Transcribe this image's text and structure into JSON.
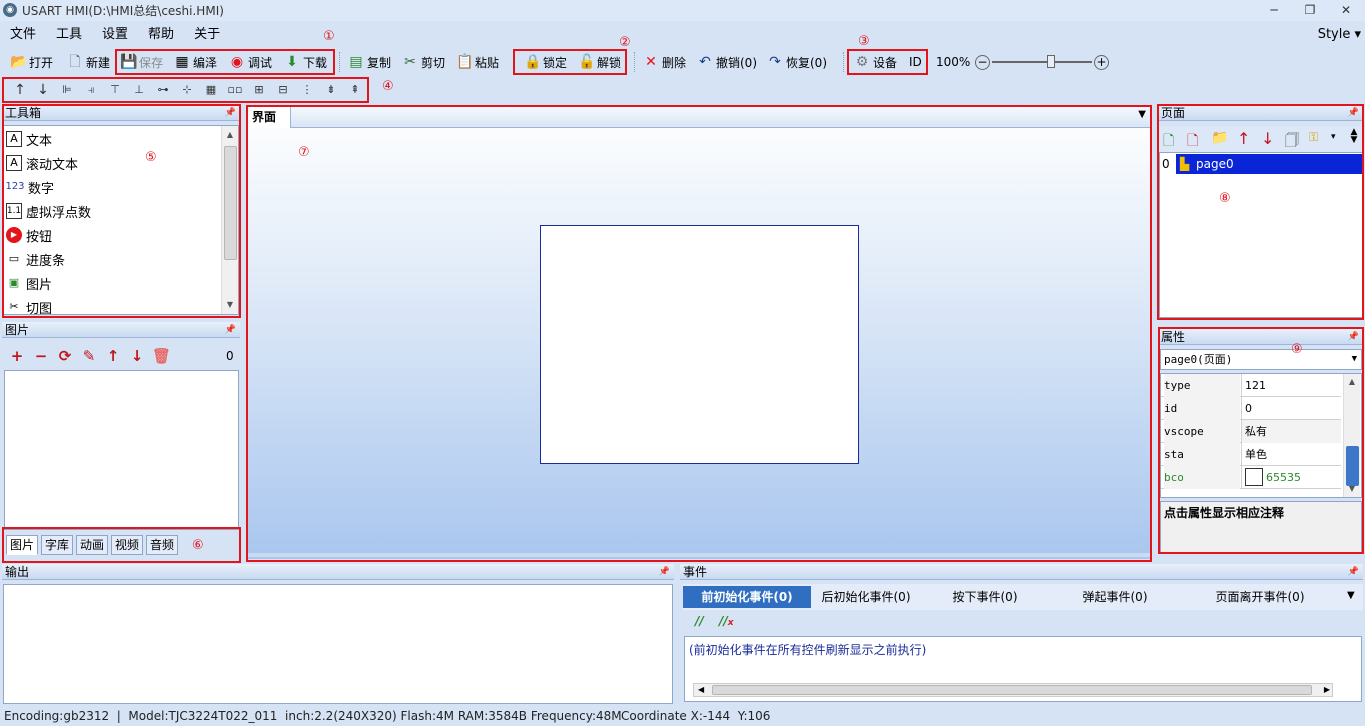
{
  "window": {
    "title": "USART HMI(D:\\HMI总结\\ceshi.HMI)",
    "minimize": "─",
    "restore": "❐",
    "close": "✕"
  },
  "menu": {
    "items": [
      "文件",
      "工具",
      "设置",
      "帮助",
      "关于"
    ],
    "style": "Style ▾"
  },
  "toolbar": {
    "open": "打开",
    "new": "新建",
    "save": "保存",
    "compile": "编泽",
    "debug": "调试",
    "download": "下载",
    "copy": "复制",
    "cut": "剪切",
    "paste": "粘贴",
    "lock": "锁定",
    "unlock": "解锁",
    "delete": "删除",
    "undo": "撤销(0)",
    "redo": "恢复(0)",
    "device": "设备",
    "id": "ID",
    "zoom": "100%"
  },
  "annotations": [
    "①",
    "②",
    "③",
    "④",
    "⑤",
    "⑥",
    "⑦",
    "⑧",
    "⑨"
  ],
  "toolbox": {
    "title": "工具箱",
    "items": [
      {
        "label": "文本",
        "icon": "A"
      },
      {
        "label": "滚动文本",
        "icon": "A"
      },
      {
        "label": "数字",
        "icon": "123"
      },
      {
        "label": "虚拟浮点数",
        "icon": "1.1"
      },
      {
        "label": "按钮",
        "icon": "▶"
      },
      {
        "label": "进度条",
        "icon": "▭"
      },
      {
        "label": "图片",
        "icon": "▣"
      },
      {
        "label": "切图",
        "icon": "✂"
      }
    ]
  },
  "pictures": {
    "title": "图片",
    "count": "0"
  },
  "resource_tabs": [
    "图片",
    "字库",
    "动画",
    "视频",
    "音频"
  ],
  "design": {
    "tab": "界面"
  },
  "pages": {
    "title": "页面",
    "items": [
      {
        "index": "0",
        "name": "page0"
      }
    ]
  },
  "properties": {
    "title": "属性",
    "selector": "page0(页面)",
    "rows": [
      {
        "key": "type",
        "value": "121"
      },
      {
        "key": "id",
        "value": "0"
      },
      {
        "key": "vscope",
        "value": "私有"
      },
      {
        "key": "sta",
        "value": "单色"
      },
      {
        "key": "bco",
        "value": "65535"
      }
    ],
    "hint": "点击属性显示相应注释",
    "bco_color": "#ffffff"
  },
  "output": {
    "title": "输出"
  },
  "events": {
    "title": "事件",
    "tabs": [
      "前初始化事件(0)",
      "后初始化事件(0)",
      "按下事件(0)",
      "弹起事件(0)",
      "页面离开事件(0)"
    ],
    "note": "(前初始化事件在所有控件刷新显示之前执行)"
  },
  "status": {
    "info": "Encoding:gb2312  |  Model:TJC3224T022_011  inch:2.2(240X320) Flash:4M RAM:3584B Frequency:48M",
    "coord": "Coordinate X:-144  Y:106"
  },
  "colors": {
    "accent_red": "#e3141a",
    "selected": "#0a24d8",
    "tab_active": "#2f6ec0"
  }
}
